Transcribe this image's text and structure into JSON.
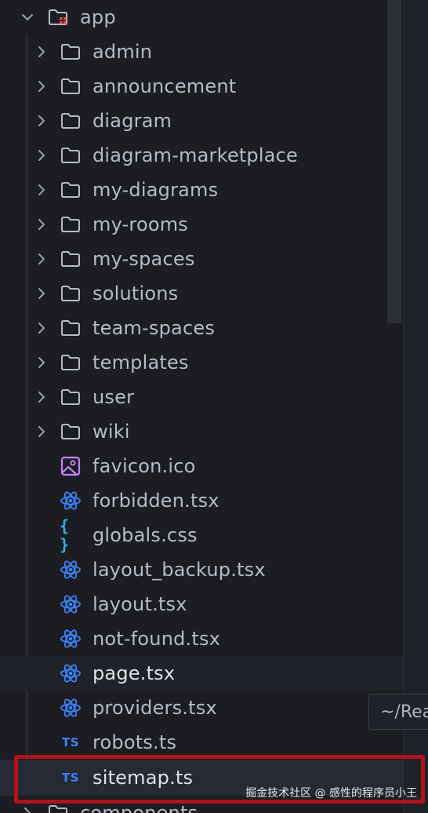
{
  "tree": {
    "root": {
      "label": "app",
      "icon": "app-folder-icon"
    },
    "folders": [
      {
        "label": "admin"
      },
      {
        "label": "announcement"
      },
      {
        "label": "diagram"
      },
      {
        "label": "diagram-marketplace"
      },
      {
        "label": "my-diagrams"
      },
      {
        "label": "my-rooms"
      },
      {
        "label": "my-spaces"
      },
      {
        "label": "solutions"
      },
      {
        "label": "team-spaces"
      },
      {
        "label": "templates"
      },
      {
        "label": "user"
      },
      {
        "label": "wiki"
      }
    ],
    "files": [
      {
        "label": "favicon.ico",
        "icon": "image-icon"
      },
      {
        "label": "forbidden.tsx",
        "icon": "react-icon"
      },
      {
        "label": "globals.css",
        "icon": "css-braces-icon",
        "glyph": "{ }"
      },
      {
        "label": "layout_backup.tsx",
        "icon": "react-icon"
      },
      {
        "label": "layout.tsx",
        "icon": "react-icon"
      },
      {
        "label": "not-found.tsx",
        "icon": "react-icon"
      },
      {
        "label": "page.tsx",
        "icon": "react-icon"
      },
      {
        "label": "providers.tsx",
        "icon": "react-icon"
      },
      {
        "label": "robots.ts",
        "icon": "typescript-icon",
        "glyph": "TS"
      },
      {
        "label": "sitemap.ts",
        "icon": "typescript-icon",
        "glyph": "TS"
      }
    ],
    "next_folder": {
      "label": "components"
    }
  },
  "tooltip": {
    "text": "~/Rea"
  },
  "watermark": {
    "text": "掘金技术社区 @ 感性的程序员小王"
  },
  "colors": {
    "background": "#1b1d22",
    "text": "#b7bbc5",
    "react": "#3b82f6",
    "typescript": "#3b82f6",
    "css": "#34b3e6",
    "image": "#c084fc",
    "app_folder_dot": "#ef4444",
    "highlight": "#b0131c"
  }
}
